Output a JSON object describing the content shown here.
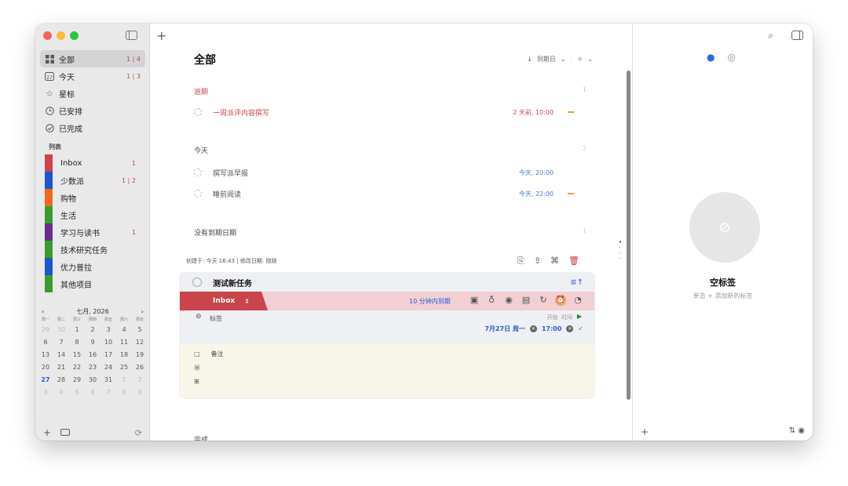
{
  "sidebar": {
    "nav": [
      {
        "label": "全部",
        "count": "1 | 4",
        "icon": "grid-icon"
      },
      {
        "label": "今天",
        "count": "1 | 3",
        "icon": "calendar-day-icon",
        "day": "27"
      },
      {
        "label": "星标",
        "count": "",
        "icon": "star-icon"
      },
      {
        "label": "已安排",
        "count": "",
        "icon": "clock-icon"
      },
      {
        "label": "已完成",
        "count": "",
        "icon": "check-circle-icon"
      }
    ],
    "lists_title": "列表",
    "lists": [
      {
        "label": "Inbox",
        "count": "1",
        "color": "#c9444b"
      },
      {
        "label": "少数派",
        "count": "1 | 2",
        "color": "#1d56c9"
      },
      {
        "label": "购物",
        "count": "",
        "color": "#f06a1d"
      },
      {
        "label": "生活",
        "count": "",
        "color": "#3a9a2e"
      },
      {
        "label": "学习与读书",
        "count": "1",
        "color": "#6a2d91"
      },
      {
        "label": "技术研究任务",
        "count": "",
        "color": "#3a9a2e"
      },
      {
        "label": "优力普拉",
        "count": "",
        "color": "#1d56c9"
      },
      {
        "label": "其他项目",
        "count": "",
        "color": "#3a9a2e"
      }
    ],
    "calendar": {
      "month_label": "七月, 2026",
      "weekdays": [
        "周一",
        "周二",
        "周三",
        "周四",
        "周五",
        "周六",
        "周日"
      ],
      "weeks": [
        [
          "29",
          "30",
          "1",
          "2",
          "3",
          "4",
          "5"
        ],
        [
          "6",
          "7",
          "8",
          "9",
          "10",
          "11",
          "12"
        ],
        [
          "13",
          "14",
          "15",
          "16",
          "17",
          "18",
          "19"
        ],
        [
          "20",
          "21",
          "22",
          "23",
          "24",
          "25",
          "26"
        ],
        [
          "27",
          "28",
          "29",
          "30",
          "31",
          "1",
          "2"
        ],
        [
          "3",
          "4",
          "5",
          "6",
          "7",
          "8",
          "9"
        ]
      ],
      "today": "27"
    }
  },
  "main": {
    "title": "全部",
    "sort_label": "到期日",
    "sections": [
      {
        "title": "逾期",
        "count": "1",
        "color": "#c9444b"
      },
      {
        "title": "今天",
        "count": "2",
        "color": "#444"
      },
      {
        "title": "没有到期日期",
        "count": "1",
        "color": "#444"
      }
    ],
    "overdue_task": {
      "title": "一周派评内容撰写",
      "due": "2 天前, 10:00"
    },
    "today_tasks": [
      {
        "title": "撰写派早报",
        "due": "今天, 20:00"
      },
      {
        "title": "睡前阅读",
        "due": "今天, 22:00"
      }
    ],
    "meta": "创建于: 今天 16:43  |  修改日期: 刚刚",
    "editing_task": {
      "title": "测试新任务",
      "list": "Inbox",
      "due_note": "10 分钟内到期",
      "tags_label": "标签",
      "start_label": "开始",
      "time_label": "时间",
      "date": "7月27日 周一",
      "time": "17:00",
      "notes_label": "备注"
    },
    "completed_label": "完成"
  },
  "inspector": {
    "empty_title": "空标签",
    "empty_sub": "单击 + 添加新的标签"
  }
}
